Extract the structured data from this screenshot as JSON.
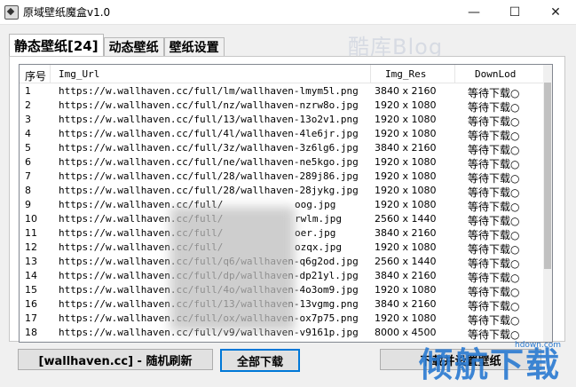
{
  "window": {
    "title": "原域壁纸魔盒v1.0"
  },
  "controls": {
    "minimize": "—",
    "maximize": "☐",
    "close": "✕"
  },
  "tabs": [
    {
      "label": "静态壁纸[24]"
    },
    {
      "label": "动态壁纸"
    },
    {
      "label": "壁纸设置"
    }
  ],
  "watermark": {
    "top": "酷库Blog",
    "big": "倾航下载",
    "site": "hdown.com"
  },
  "table": {
    "headers": {
      "no": "序号",
      "url": "Img_Url",
      "res": "Img_Res",
      "dl": "DownLod"
    },
    "rows": [
      {
        "no": "1",
        "url": "https://w.wallhaven.cc/full/lm/wallhaven-lmym5l.png",
        "res": "3840 x 2160",
        "dl": "等待下载○"
      },
      {
        "no": "2",
        "url": "https://w.wallhaven.cc/full/nz/wallhaven-nzrw8o.jpg",
        "res": "1920 x 1080",
        "dl": "等待下载○"
      },
      {
        "no": "3",
        "url": "https://w.wallhaven.cc/full/13/wallhaven-13o2v1.png",
        "res": "1920 x 1080",
        "dl": "等待下载○"
      },
      {
        "no": "4",
        "url": "https://w.wallhaven.cc/full/4l/wallhaven-4le6jr.jpg",
        "res": "1920 x 1080",
        "dl": "等待下载○"
      },
      {
        "no": "5",
        "url": "https://w.wallhaven.cc/full/3z/wallhaven-3z6lg6.jpg",
        "res": "3840 x 2160",
        "dl": "等待下载○"
      },
      {
        "no": "6",
        "url": "https://w.wallhaven.cc/full/ne/wallhaven-ne5kgo.jpg",
        "res": "1920 x 1080",
        "dl": "等待下载○"
      },
      {
        "no": "7",
        "url": "https://w.wallhaven.cc/full/28/wallhaven-289j86.jpg",
        "res": "1920 x 1080",
        "dl": "等待下载○"
      },
      {
        "no": "8",
        "url": "https://w.wallhaven.cc/full/28/wallhaven-28jykg.jpg",
        "res": "1920 x 1080",
        "dl": "等待下载○"
      },
      {
        "no": "9",
        "url": "https://w.wallhaven.cc/full/",
        "url2": "oog.jpg",
        "res": "1920 x 1080",
        "dl": "等待下载○"
      },
      {
        "no": "10",
        "url": "https://w.wallhaven.cc/full/",
        "url2": "rwlm.jpg",
        "res": "2560 x 1440",
        "dl": "等待下载○"
      },
      {
        "no": "11",
        "url": "https://w.wallhaven.cc/full/",
        "url2": "oer.jpg",
        "res": "3840 x 2160",
        "dl": "等待下载○"
      },
      {
        "no": "12",
        "url": "https://w.wallhaven.cc/full/",
        "url2": "ozqx.jpg",
        "res": "1920 x 1080",
        "dl": "等待下载○"
      },
      {
        "no": "13",
        "url": "https://w.wallhaven.cc/full/q6/wallhaven-q6g2od.jpg",
        "res": "2560 x 1440",
        "dl": "等待下载○"
      },
      {
        "no": "14",
        "url": "https://w.wallhaven.cc/full/dp/wallhaven-dp21yl.jpg",
        "res": "3840 x 2160",
        "dl": "等待下载○"
      },
      {
        "no": "15",
        "url": "https://w.wallhaven.cc/full/4o/wallhaven-4o3om9.jpg",
        "res": "1920 x 1080",
        "dl": "等待下载○"
      },
      {
        "no": "16",
        "url": "https://w.wallhaven.cc/full/13/wallhaven-13vgmg.png",
        "res": "3840 x 2160",
        "dl": "等待下载○"
      },
      {
        "no": "17",
        "url": "https://w.wallhaven.cc/full/ox/wallhaven-ox7p75.png",
        "res": "1920 x 1080",
        "dl": "等待下载○"
      },
      {
        "no": "18",
        "url": "https://w.wallhaven.cc/full/v9/wallhaven-v9161p.jpg",
        "res": "8000 x 4500",
        "dl": "等待下载○"
      }
    ]
  },
  "buttons": {
    "random": "[wallhaven.cc] - 随机刷新",
    "download_all": "全部下载",
    "set_wallpaper": "下载并设置壁纸"
  }
}
